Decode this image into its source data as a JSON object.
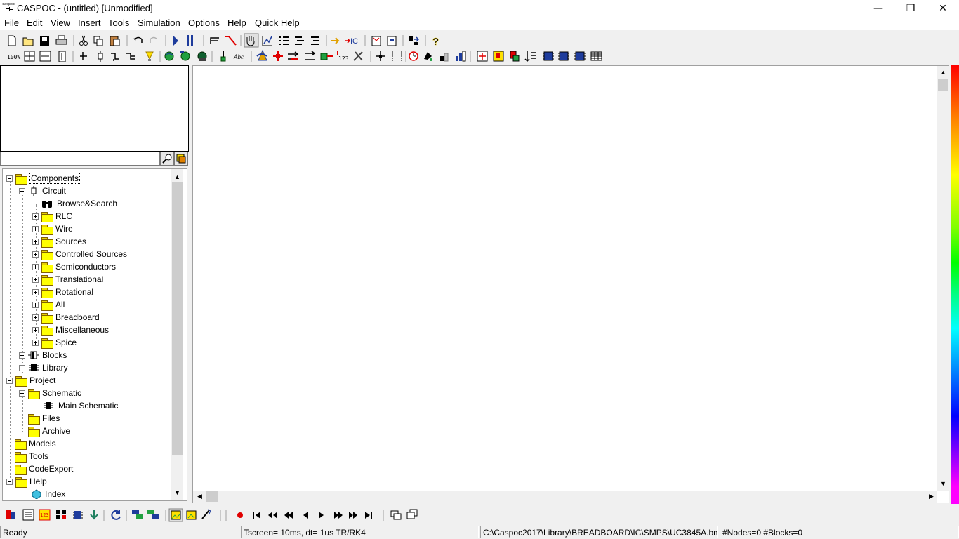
{
  "window": {
    "title": "CASPOC - (untitled) [Unmodified]",
    "app_icon": "caspoc-logo",
    "app_icon_text": "caspoc",
    "controls": {
      "minimize": "—",
      "restore": "❐",
      "close": "✕"
    }
  },
  "menu": [
    {
      "label": "File",
      "u": "F",
      "rest": "ile"
    },
    {
      "label": "Edit",
      "u": "E",
      "rest": "dit"
    },
    {
      "label": "View",
      "u": "V",
      "rest": "iew"
    },
    {
      "label": "Insert",
      "u": "I",
      "rest": "nsert"
    },
    {
      "label": "Tools",
      "u": "T",
      "rest": "ools"
    },
    {
      "label": "Simulation",
      "u": "S",
      "rest": "imulation"
    },
    {
      "label": "Options",
      "u": "O",
      "rest": "ptions"
    },
    {
      "label": "Help",
      "u": "H",
      "rest": "elp"
    },
    {
      "label": "Quick Help",
      "u": "Q",
      "rest": "uick Help"
    }
  ],
  "toolbar1": [
    "new-file-icon",
    "open-folder-icon",
    "save-icon",
    "print-icon",
    "cut-icon",
    "copy-icon",
    "paste-icon",
    "undo-icon",
    "redo-icon",
    "run-simulation-icon",
    "pause-simulation-icon",
    "scope-icon",
    "probe-icon",
    "hand-pan-icon",
    "plot-icon",
    "list-icon",
    "list-indent-icon",
    "list-sort-icon",
    "arrow-right-icon",
    "initial-condition-icon",
    "component-properties-icon",
    "block-properties-icon",
    "swap-icon",
    "help-question-icon"
  ],
  "toolbar1_text": {
    "zoom100": "100%",
    "ic": "IC",
    "abc": "Abc",
    "num": "123"
  },
  "toolbar2": [
    "zoom-100-icon",
    "zoom-fit-icon",
    "zoom-width-icon",
    "zoom-height-icon",
    "node-icon",
    "component-icon",
    "wire-bend-icon",
    "wire-split-icon",
    "lamp-icon",
    "globe-icon",
    "globe-network-icon",
    "globe-dark-icon",
    "pen-icon",
    "text-abc-icon",
    "rotate-icon",
    "cross-red-icon",
    "arrows-icon",
    "measure-icon",
    "arrow-switch-icon",
    "block-green-icon",
    "number-123-icon",
    "tools-icon",
    "crosshair-icon",
    "grid-dots-icon",
    "clock-icon",
    "paint-icon",
    "bar-level-icon",
    "bar-chart-icon",
    "fit-all-icon",
    "zoom-in-icon",
    "zoom-select-icon",
    "sort-icon",
    "chip-icon",
    "chip-2-icon",
    "chip-3-icon",
    "table-icon"
  ],
  "tree": {
    "search_placeholder": "",
    "nodes": [
      {
        "label": "Components",
        "level": 0,
        "expander": "minus",
        "icon": "folder",
        "selected": true
      },
      {
        "label": "Circuit",
        "level": 1,
        "expander": "minus",
        "icon": "circuit"
      },
      {
        "label": "Browse&Search",
        "level": 2,
        "expander": "none",
        "icon": "binoculars"
      },
      {
        "label": "RLC",
        "level": 2,
        "expander": "plus",
        "icon": "folder"
      },
      {
        "label": "Wire",
        "level": 2,
        "expander": "plus",
        "icon": "folder"
      },
      {
        "label": "Sources",
        "level": 2,
        "expander": "plus",
        "icon": "folder"
      },
      {
        "label": "Controlled Sources",
        "level": 2,
        "expander": "plus",
        "icon": "folder"
      },
      {
        "label": "Semiconductors",
        "level": 2,
        "expander": "plus",
        "icon": "folder"
      },
      {
        "label": "Translational",
        "level": 2,
        "expander": "plus",
        "icon": "folder"
      },
      {
        "label": "Rotational",
        "level": 2,
        "expander": "plus",
        "icon": "folder"
      },
      {
        "label": "All",
        "level": 2,
        "expander": "plus",
        "icon": "folder"
      },
      {
        "label": "Breadboard",
        "level": 2,
        "expander": "plus",
        "icon": "folder"
      },
      {
        "label": "Miscellaneous",
        "level": 2,
        "expander": "plus",
        "icon": "folder"
      },
      {
        "label": "Spice",
        "level": 2,
        "expander": "plus",
        "icon": "folder"
      },
      {
        "label": "Blocks",
        "level": 1,
        "expander": "plus",
        "icon": "block"
      },
      {
        "label": "Library",
        "level": 1,
        "expander": "plus",
        "icon": "chip"
      },
      {
        "label": "Project",
        "level": 0,
        "expander": "minus",
        "icon": "folder"
      },
      {
        "label": "Schematic",
        "level": 1,
        "expander": "minus",
        "icon": "folder"
      },
      {
        "label": "Main Schematic",
        "level": 2,
        "expander": "none",
        "icon": "chip"
      },
      {
        "label": "Files",
        "level": 1,
        "expander": "none",
        "icon": "folder"
      },
      {
        "label": "Archive",
        "level": 1,
        "expander": "none",
        "icon": "folder"
      },
      {
        "label": "Models",
        "level": 0,
        "expander": "none",
        "icon": "folder"
      },
      {
        "label": "Tools",
        "level": 0,
        "expander": "none",
        "icon": "folder"
      },
      {
        "label": "CodeExport",
        "level": 0,
        "expander": "none",
        "icon": "folder"
      },
      {
        "label": "Help",
        "level": 0,
        "expander": "minus",
        "icon": "folder"
      },
      {
        "label": "Index",
        "level": 1,
        "expander": "none",
        "icon": "gem"
      }
    ]
  },
  "bottom_toolbar": [
    "component-library-icon",
    "text-window-icon",
    "number-display-icon",
    "table-view-icon",
    "chip-view-icon",
    "download-icon",
    "refresh-icon",
    "network-icon",
    "network-2-icon",
    "image-icon",
    "image-2-icon",
    "wand-icon",
    "record-icon",
    "go-start-icon",
    "fast-rewind-icon",
    "rewind-icon",
    "step-back-icon",
    "play-icon",
    "step-forward-icon",
    "fast-forward-icon",
    "go-end-icon",
    "windows-icon",
    "windows-2-icon"
  ],
  "status": {
    "ready": "Ready",
    "tscreen": "Tscreen= 10ms, dt= 1us TR/RK4",
    "path": "C:\\Caspoc2017\\Library\\BREADBOARD\\IC\\SMPS\\UC3845A.bmp",
    "counts": "#Nodes=0 #Blocks=0"
  },
  "colors": {
    "accent_blue": "#1e3c9c",
    "folder_yellow": "#ffff00",
    "record_red": "#e00000"
  }
}
